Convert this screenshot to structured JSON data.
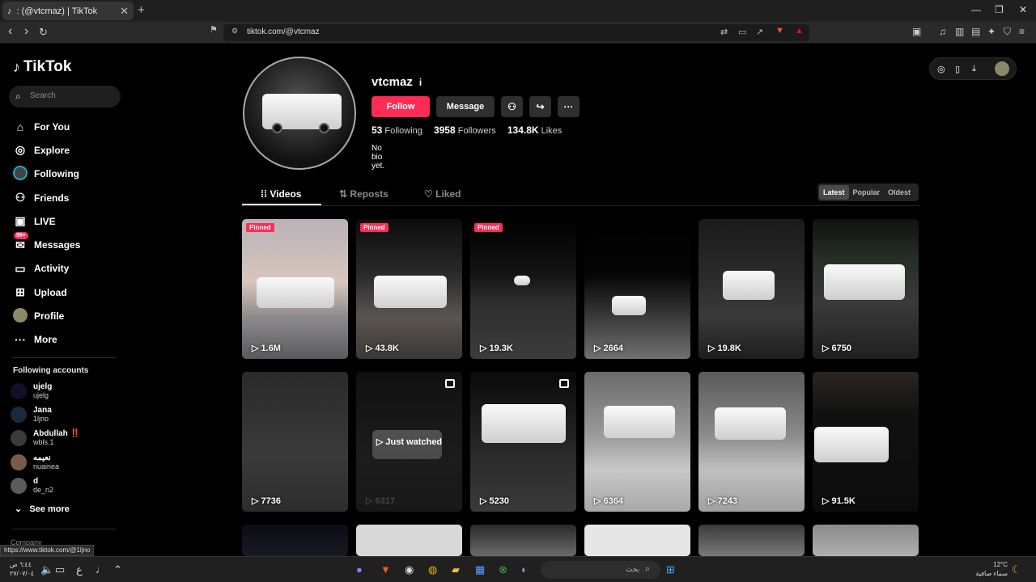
{
  "browser": {
    "tab_title": "(@vtcmaz) | TikTok",
    "tab_prefix": ":",
    "url": "tiktok.com/@vtcmaz",
    "status_url": "https://www.tiktok.com/@1ljno"
  },
  "sidebar": {
    "brand": "TikTok",
    "search_placeholder": "Search",
    "items": [
      {
        "label": "For You"
      },
      {
        "label": "Explore"
      },
      {
        "label": "Following"
      },
      {
        "label": "Friends"
      },
      {
        "label": "LIVE"
      },
      {
        "label": "Messages",
        "badge": "99+"
      },
      {
        "label": "Activity"
      },
      {
        "label": "Upload"
      },
      {
        "label": "Profile"
      },
      {
        "label": "More"
      }
    ],
    "following_title": "Following accounts",
    "following": [
      {
        "name": "ujelg",
        "handle": "ujelg"
      },
      {
        "name": "Jana",
        "handle": "1ljno"
      },
      {
        "name": "Abdullah ‼️",
        "handle": "wbls.1"
      },
      {
        "name": "نعيمه",
        "handle": "nuainea"
      },
      {
        "name": "d",
        "handle": "de_n2"
      }
    ],
    "see_more": "See more",
    "company": "Company"
  },
  "profile": {
    "username": "vtcmaz",
    "info_icon": "i",
    "follow_label": "Follow",
    "message_label": "Message",
    "following_count": "53",
    "following_label": "Following",
    "followers_count": "3958",
    "followers_label": "Followers",
    "likes_count": "134.8K",
    "likes_label": "Likes",
    "bio": "No bio yet."
  },
  "tabs": {
    "videos": "Videos",
    "reposts": "Reposts",
    "liked": "Liked"
  },
  "sort": {
    "latest": "Latest",
    "popular": "Popular",
    "oldest": "Oldest"
  },
  "pinned_label": "Pinned",
  "videos": [
    {
      "views": "1.6M"
    },
    {
      "views": "43.8K"
    },
    {
      "views": "19.3K"
    },
    {
      "views": "2664"
    },
    {
      "views": "19.8K"
    },
    {
      "views": "6750"
    },
    {
      "views": "7736"
    },
    {
      "views": "6317",
      "overlay": "Just watched"
    },
    {
      "views": "5230"
    },
    {
      "views": "6364"
    },
    {
      "views": "7243"
    },
    {
      "views": "91.5K"
    }
  ],
  "taskbar": {
    "search_label": "بحث",
    "temperature": "12°C",
    "weather": "سماء صافية",
    "time": "٦:٤٤ ص",
    "date": "٢٧/٠٧/٠٤"
  },
  "colors": {
    "accent": "#fe2c55",
    "background": "#000000"
  }
}
